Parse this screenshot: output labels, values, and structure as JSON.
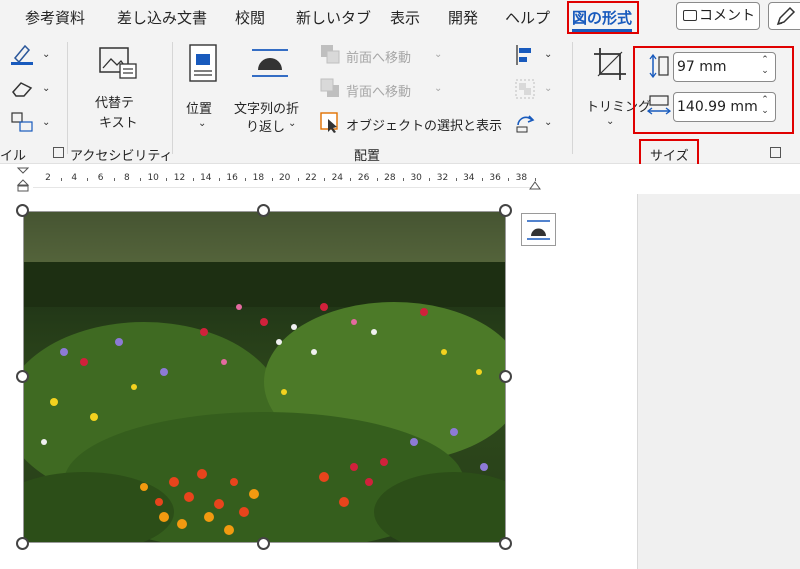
{
  "tabs": {
    "references": "参考資料",
    "mailings": "差し込み文書",
    "review": "校閲",
    "new_tab": "新しいタブ",
    "view": "表示",
    "developer": "開発",
    "help": "ヘルプ",
    "picture_format": "図の形式"
  },
  "header": {
    "comment_label": "コメント"
  },
  "ribbon": {
    "styles_group_label": "イル",
    "alt_text_line1": "代替テ",
    "alt_text_line2": "キスト",
    "accessibility_group_label": "アクセシビリティ",
    "position_label": "位置",
    "wrap_text_line1": "文字列の折",
    "wrap_text_line2": "り返し",
    "bring_forward_label": "前面へ移動",
    "send_backward_label": "背面へ移動",
    "selection_pane_label": "オブジェクトの選択と表示",
    "arrange_group_label": "配置",
    "crop_label": "トリミング",
    "height_value": "97 mm",
    "width_value": "140.99 mm",
    "size_group_label": "サイズ"
  },
  "ruler": {
    "ticks": [
      "2",
      "4",
      "6",
      "8",
      "10",
      "12",
      "14",
      "16",
      "18",
      "20",
      "22",
      "24",
      "26",
      "28",
      "30",
      "32",
      "34",
      "36",
      "38"
    ]
  },
  "colors": {
    "accent": "#185abd",
    "highlight_box": "#e00000"
  }
}
